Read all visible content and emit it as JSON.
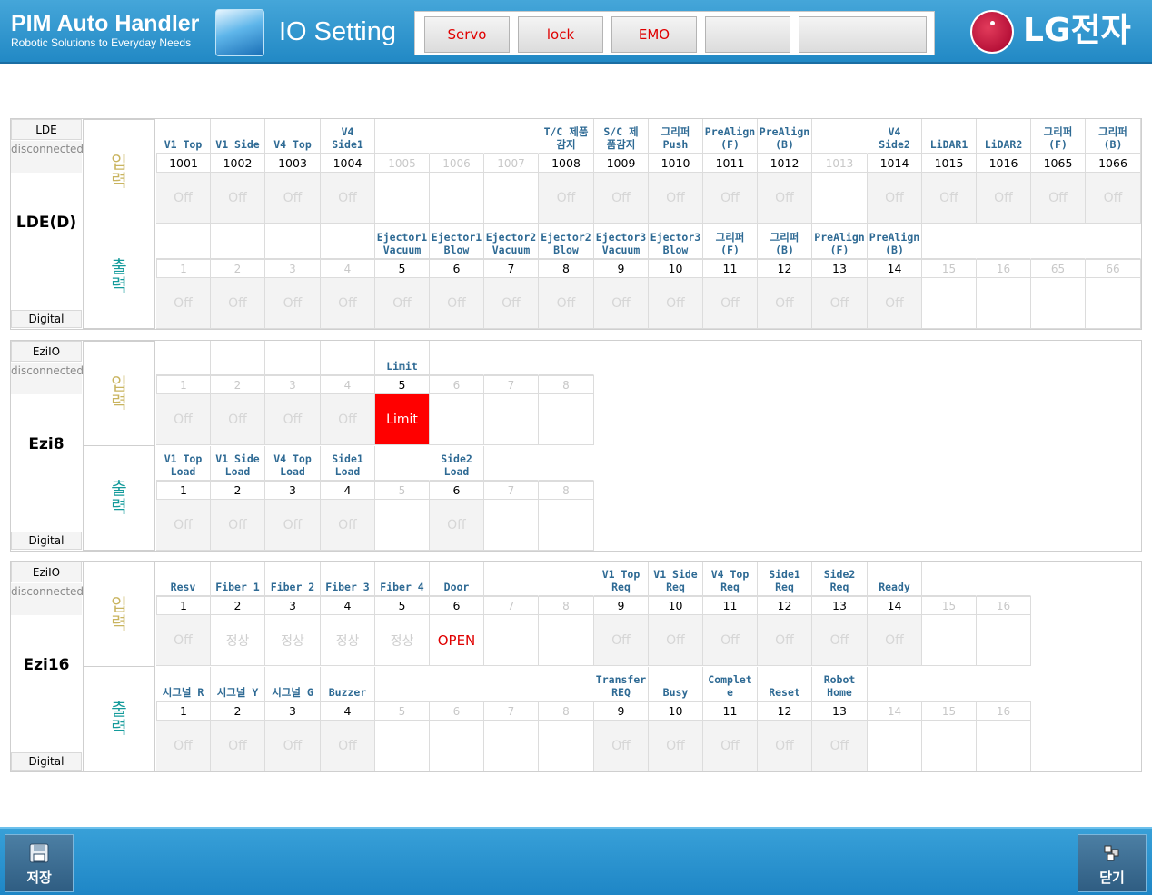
{
  "header": {
    "app_title": "PIM Auto Handler",
    "app_subtitle": "Robotic Solutions to Everyday Needs",
    "page_title": "IO Setting",
    "status_buttons": [
      "Servo",
      "lock",
      "EMO",
      "",
      ""
    ],
    "logo_text": "LG전자",
    "accent_color": "#2289c5",
    "alarm_text_color": "#e00000"
  },
  "io_labels": {
    "input": "입력",
    "output": "출력",
    "input_color": "#c9b45f",
    "output_color": "#149b9b"
  },
  "panels": [
    {
      "device_type": "LDE",
      "status": "disconnected",
      "name": "LDE(D)",
      "bottom": "Digital",
      "input": {
        "labels": [
          "V1 Top",
          "V1 Side",
          "V4 Top",
          "V4\nSide1",
          "",
          "",
          "",
          "T/C 제품\n감지",
          "S/C 제\n품감지",
          "그리퍼\nPush",
          "PreAlign\n(F)",
          "PreAlign\n(B)",
          "",
          "V4\nSide2",
          "LiDAR1",
          "LiDAR2",
          "그리퍼\n(F)",
          "그리퍼\n(B)"
        ],
        "numbers": [
          "1001",
          "1002",
          "1003",
          "1004",
          "1005",
          "1006",
          "1007",
          "1008",
          "1009",
          "1010",
          "1011",
          "1012",
          "1013",
          "1014",
          "1015",
          "1016",
          "1065",
          "1066"
        ],
        "num_active": [
          true,
          true,
          true,
          true,
          false,
          false,
          false,
          true,
          true,
          true,
          true,
          true,
          false,
          true,
          true,
          true,
          true,
          true
        ],
        "states": [
          "Off",
          "Off",
          "Off",
          "Off",
          "",
          "",
          "",
          "Off",
          "Off",
          "Off",
          "Off",
          "Off",
          "",
          "Off",
          "Off",
          "Off",
          "Off",
          "Off"
        ]
      },
      "output": {
        "labels": [
          "",
          "",
          "",
          "",
          "Ejector1\nVacuum",
          "Ejector1\nBlow",
          "Ejector2\nVacuum",
          "Ejector2\nBlow",
          "Ejector3\nVacuum",
          "Ejector3\nBlow",
          "그리퍼\n(F)",
          "그리퍼\n(B)",
          "PreAlign\n(F)",
          "PreAlign\n(B)",
          "",
          "",
          "",
          ""
        ],
        "numbers": [
          "1",
          "2",
          "3",
          "4",
          "5",
          "6",
          "7",
          "8",
          "9",
          "10",
          "11",
          "12",
          "13",
          "14",
          "15",
          "16",
          "65",
          "66"
        ],
        "num_active": [
          false,
          false,
          false,
          false,
          true,
          true,
          true,
          true,
          true,
          true,
          true,
          true,
          true,
          true,
          false,
          false,
          false,
          false
        ],
        "states": [
          "Off",
          "Off",
          "Off",
          "Off",
          "Off",
          "Off",
          "Off",
          "Off",
          "Off",
          "Off",
          "Off",
          "Off",
          "Off",
          "Off",
          "",
          "",
          "",
          ""
        ]
      }
    },
    {
      "device_type": "EziIO",
      "status": "disconnected",
      "name": "Ezi8",
      "bottom": "Digital",
      "input": {
        "labels": [
          "",
          "",
          "",
          "",
          "Limit",
          "",
          "",
          ""
        ],
        "numbers": [
          "1",
          "2",
          "3",
          "4",
          "5",
          "6",
          "7",
          "8"
        ],
        "num_active": [
          false,
          false,
          false,
          false,
          true,
          false,
          false,
          false
        ],
        "states": [
          "Off",
          "Off",
          "Off",
          "Off",
          "Limit",
          "",
          "",
          ""
        ]
      },
      "output": {
        "labels": [
          "V1 Top\nLoad",
          "V1 Side\nLoad",
          "V4 Top\nLoad",
          "Side1\nLoad",
          "",
          "Side2\nLoad",
          "",
          ""
        ],
        "numbers": [
          "1",
          "2",
          "3",
          "4",
          "5",
          "6",
          "7",
          "8"
        ],
        "num_active": [
          true,
          true,
          true,
          true,
          false,
          true,
          false,
          false
        ],
        "states": [
          "Off",
          "Off",
          "Off",
          "Off",
          "",
          "Off",
          "",
          ""
        ]
      }
    },
    {
      "device_type": "EziIO",
      "status": "disconnected",
      "name": "Ezi16",
      "bottom": "Digital",
      "input": {
        "labels": [
          "Resv",
          "Fiber 1",
          "Fiber 2",
          "Fiber 3",
          "Fiber 4",
          "Door",
          "",
          "",
          "V1 Top\nReq",
          "V1 Side\nReq",
          "V4 Top\nReq",
          "Side1\nReq",
          "Side2\nReq",
          "Ready",
          "",
          ""
        ],
        "numbers": [
          "1",
          "2",
          "3",
          "4",
          "5",
          "6",
          "7",
          "8",
          "9",
          "10",
          "11",
          "12",
          "13",
          "14",
          "15",
          "16"
        ],
        "num_active": [
          true,
          true,
          true,
          true,
          true,
          true,
          false,
          false,
          true,
          true,
          true,
          true,
          true,
          true,
          false,
          false
        ],
        "states": [
          "Off",
          "정상",
          "정상",
          "정상",
          "정상",
          "OPEN",
          "",
          "",
          "Off",
          "Off",
          "Off",
          "Off",
          "Off",
          "Off",
          "",
          ""
        ]
      },
      "output": {
        "labels": [
          "시그널 R",
          "시그널 Y",
          "시그널 G",
          "Buzzer",
          "",
          "",
          "",
          "",
          "Transfer\nREQ",
          "Busy",
          "Complet\ne",
          "Reset",
          "Robot\nHome",
          "",
          "",
          ""
        ],
        "numbers": [
          "1",
          "2",
          "3",
          "4",
          "5",
          "6",
          "7",
          "8",
          "9",
          "10",
          "11",
          "12",
          "13",
          "14",
          "15",
          "16"
        ],
        "num_active": [
          true,
          true,
          true,
          true,
          false,
          false,
          false,
          false,
          true,
          true,
          true,
          true,
          true,
          false,
          false,
          false
        ],
        "states": [
          "Off",
          "Off",
          "Off",
          "Off",
          "",
          "",
          "",
          "",
          "Off",
          "Off",
          "Off",
          "Off",
          "Off",
          "",
          "",
          ""
        ]
      }
    }
  ],
  "footer": {
    "save_label": "저장",
    "close_label": "닫기"
  }
}
